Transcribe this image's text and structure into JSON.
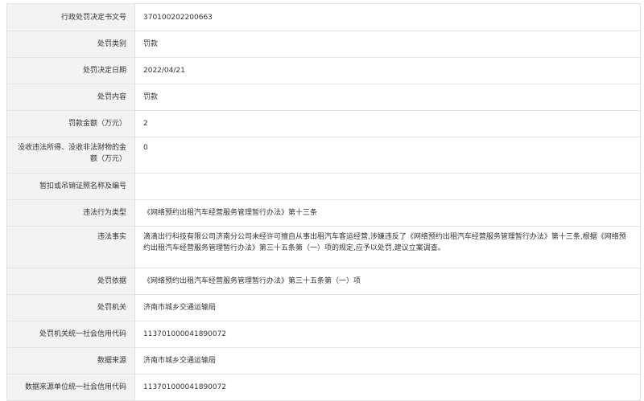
{
  "rows": [
    {
      "label": "行政处罚决定书文号",
      "value": "370100202200663"
    },
    {
      "label": "处罚类别",
      "value": "罚款"
    },
    {
      "label": "处罚决定日期",
      "value": "2022/04/21"
    },
    {
      "label": "处罚内容",
      "value": "罚款"
    },
    {
      "label": "罚款金额（万元）",
      "value": "2"
    },
    {
      "label": "没收违法所得、没收非法财物的金额（万元）",
      "value": "0"
    },
    {
      "label": "暂扣或吊销证照名称及编号",
      "value": ""
    },
    {
      "label": "违法行为类型",
      "value": "《网络预约出租汽车经营服务管理暂行办法》第十三条"
    },
    {
      "label": "违法事实",
      "value": "滴滴出行科技有限公司济南分公司未经许可擅自从事出租汽车客运经营,涉嫌违反了《网络预约出租汽车经营服务管理暂行办法》第十三条,根据《网络预约出租汽车经营服务管理暂行办法》第三十五条第（一）项的规定,应予以处罚,建议立案调查。"
    },
    {
      "label": "处罚依据",
      "value": "《网络预约出租汽车经营服务管理暂行办法》第三十五条第（一）项"
    },
    {
      "label": "处罚机关",
      "value": "济南市城乡交通运输局"
    },
    {
      "label": "处罚机关统一社会信用代码",
      "value": "11370100004189007​2"
    },
    {
      "label": "数据来源",
      "value": "济南市城乡交通运输局"
    },
    {
      "label": "数据来源单位统一社会信用代码",
      "value": "113701000041890072"
    }
  ]
}
